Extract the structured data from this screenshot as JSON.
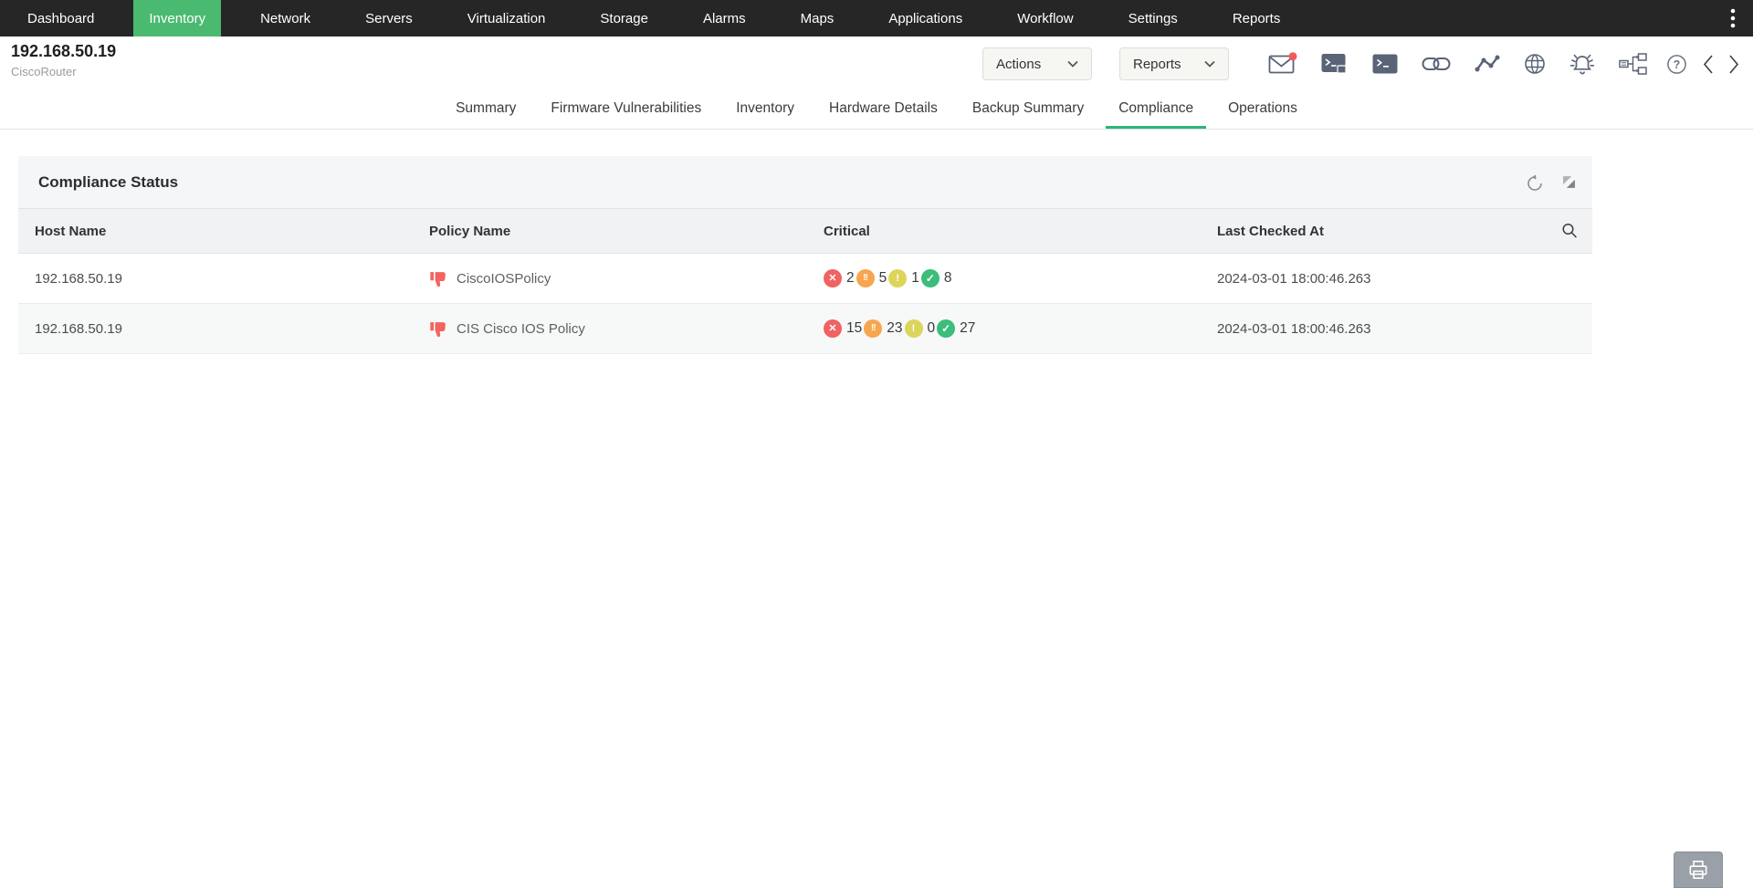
{
  "nav": {
    "bar_color": "#262626",
    "active_color": "#4aba70",
    "items": [
      {
        "label": "Dashboard",
        "active": false
      },
      {
        "label": "Inventory",
        "active": true
      },
      {
        "label": "Network",
        "active": false
      },
      {
        "label": "Servers",
        "active": false
      },
      {
        "label": "Virtualization",
        "active": false
      },
      {
        "label": "Storage",
        "active": false
      },
      {
        "label": "Alarms",
        "active": false
      },
      {
        "label": "Maps",
        "active": false
      },
      {
        "label": "Applications",
        "active": false
      },
      {
        "label": "Workflow",
        "active": false
      },
      {
        "label": "Settings",
        "active": false
      },
      {
        "label": "Reports",
        "active": false
      }
    ],
    "overflow_icon": "kebab-menu-icon"
  },
  "device_header": {
    "ip": "192.168.50.19",
    "type": "CiscoRouter",
    "actions_button": "Actions",
    "reports_button": "Reports",
    "icon_names": [
      "mail-icon",
      "secure-terminal-icon",
      "terminal-icon",
      "link-icon",
      "line-chart-icon",
      "globe-icon",
      "alarm-bell-icon",
      "workflow-diagram-icon",
      "help-icon",
      "chevron-left-icon",
      "chevron-right-icon"
    ],
    "mail_badge_color": "#f05b5b",
    "icon_color": "#5a6377"
  },
  "tabs": {
    "active_underline_color": "#2db675",
    "items": [
      {
        "label": "Summary",
        "active": false
      },
      {
        "label": "Firmware Vulnerabilities",
        "active": false
      },
      {
        "label": "Inventory",
        "active": false
      },
      {
        "label": "Hardware Details",
        "active": false
      },
      {
        "label": "Backup Summary",
        "active": false
      },
      {
        "label": "Compliance",
        "active": true
      },
      {
        "label": "Operations",
        "active": false
      }
    ]
  },
  "compliance_panel": {
    "title": "Compliance Status",
    "header_icon_names": [
      "refresh-icon",
      "resize-icon"
    ],
    "table": {
      "columns": [
        "Host Name",
        "Policy Name",
        "Critical",
        "Last Checked At"
      ],
      "search_icon": "search-icon",
      "severity_badges": [
        {
          "name": "error",
          "glyph": "✕",
          "color": "#f16262"
        },
        {
          "name": "major",
          "glyph": "!!",
          "color": "#f7a64f"
        },
        {
          "name": "minor",
          "glyph": "!",
          "color": "#dcd55b"
        },
        {
          "name": "ok",
          "glyph": "✓",
          "color": "#3cbd79"
        }
      ],
      "rows": [
        {
          "host": "192.168.50.19",
          "policy_icon": "thumbs-down-icon",
          "policy": "CiscoIOSPolicy",
          "critical": [
            "2",
            "5",
            "1",
            "8"
          ],
          "last_checked": "2024-03-01 18:00:46.263"
        },
        {
          "host": "192.168.50.19",
          "policy_icon": "thumbs-down-icon",
          "policy": "CIS Cisco IOS Policy",
          "critical": [
            "15",
            "23",
            "0",
            "27"
          ],
          "last_checked": "2024-03-01 18:00:46.263"
        }
      ]
    }
  },
  "floating": {
    "print_button_icon": "printer-icon"
  }
}
